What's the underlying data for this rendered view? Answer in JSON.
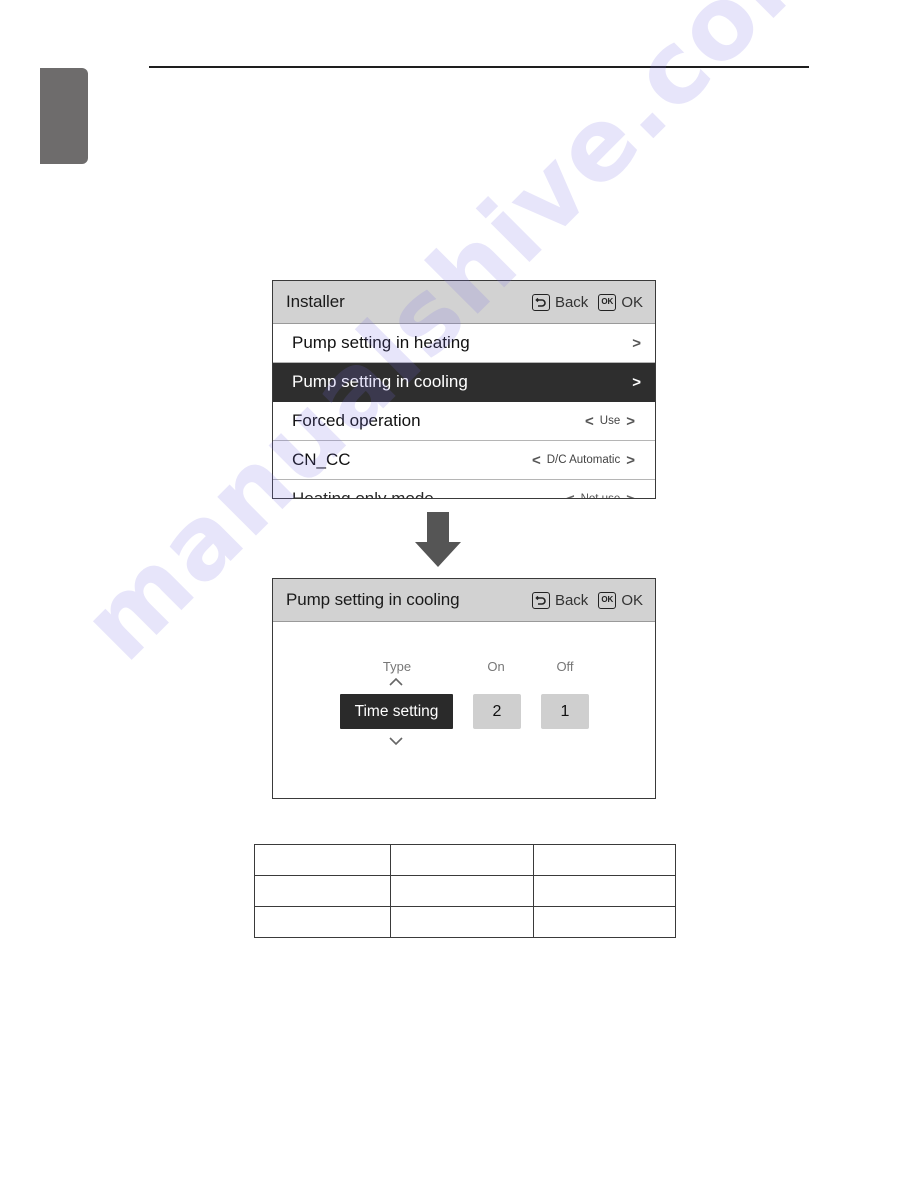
{
  "page": {
    "watermark": "manualshive.com"
  },
  "screen_installer": {
    "title": "Installer",
    "back_label": "Back",
    "ok_label": "OK",
    "ok_icon_text": "OK",
    "rows": [
      {
        "label": "Pump setting in heating",
        "value": "",
        "selected": false
      },
      {
        "label": "Pump setting in cooling",
        "value": "",
        "selected": true
      },
      {
        "label": "Forced operation",
        "value": "Use",
        "selected": false
      },
      {
        "label": "CN_CC",
        "value": "D/C Automatic",
        "selected": false
      },
      {
        "label": "Heating only mode",
        "value": "Not use",
        "selected": false
      }
    ]
  },
  "screen_pump_cooling": {
    "title": "Pump setting in cooling",
    "back_label": "Back",
    "ok_label": "OK",
    "ok_icon_text": "OK",
    "columns": {
      "type_label": "Type",
      "on_label": "On",
      "off_label": "Off"
    },
    "values": {
      "type": "Time setting",
      "on": "2",
      "off": "1"
    }
  },
  "table": {
    "rows": [
      [
        "",
        "",
        ""
      ],
      [
        "",
        "",
        ""
      ],
      [
        "",
        "",
        ""
      ]
    ]
  },
  "colors": {
    "header_bg": "#d2d2d2",
    "selected_bg": "#2e2e2e",
    "value_box_bg": "#cfcfcf",
    "arrow": "#555555",
    "side_tab": "#6e6c6c"
  }
}
